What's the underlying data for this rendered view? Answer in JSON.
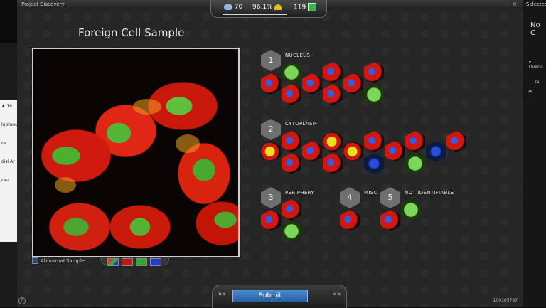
{
  "window": {
    "title": "Project Discovery"
  },
  "stats": {
    "left_value": "70",
    "accuracy": "96.1%",
    "right_value": "119",
    "progress": 0.7
  },
  "panel": {
    "title": "Foreign Cell Sample"
  },
  "left_sidebar": {
    "count": "16",
    "frag1": "luptuou",
    "frag2": "re",
    "frag3": "disi Ar",
    "frag4": "rau"
  },
  "right_sidebar": {
    "selected": "Selected",
    "no_content": "No C",
    "overview": "Overvi",
    "tab": "Ta"
  },
  "categories": [
    {
      "number": "1",
      "label": "NUCLEUS"
    },
    {
      "number": "2",
      "label": "CYTOPLASM"
    },
    {
      "number": "3",
      "label": "PERIPHERY"
    },
    {
      "number": "4",
      "label": "MISC"
    },
    {
      "number": "5",
      "label": "NOT IDENTIFIABLE"
    }
  ],
  "image_toolbar": {
    "abnormal_label": "Abnormal Sample"
  },
  "submit": {
    "label": "Submit"
  },
  "footer": {
    "id": "100105787"
  },
  "colors": {
    "accent": "#2a5fa0",
    "selected_glow": "#3aa4ff"
  }
}
